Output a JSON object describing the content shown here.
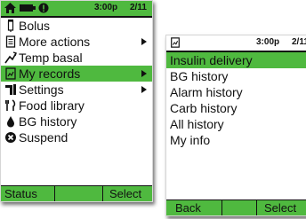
{
  "screen_main": {
    "status_bar": {
      "icons": [
        "home-icon",
        "battery-icon",
        "reservoir-icon"
      ],
      "time": "3:00p",
      "date": "2/11"
    },
    "menu": [
      {
        "label": "Bolus",
        "icon": "syringe-icon",
        "has_submenu": false,
        "selected": false
      },
      {
        "label": "More actions",
        "icon": "document-icon",
        "has_submenu": true,
        "selected": false
      },
      {
        "label": "Temp basal",
        "icon": "temp-basal-icon",
        "has_submenu": false,
        "selected": false
      },
      {
        "label": "My records",
        "icon": "records-icon",
        "has_submenu": true,
        "selected": true
      },
      {
        "label": "Settings",
        "icon": "settings-icon",
        "has_submenu": true,
        "selected": false
      },
      {
        "label": "Food library",
        "icon": "fork-knife-icon",
        "has_submenu": false,
        "selected": false
      },
      {
        "label": "BG history",
        "icon": "blood-drop-icon",
        "has_submenu": false,
        "selected": false
      },
      {
        "label": "Suspend",
        "icon": "suspend-icon",
        "has_submenu": false,
        "selected": false
      }
    ],
    "softkeys": {
      "left": "Status",
      "right": "Select"
    }
  },
  "screen_records": {
    "status_bar": {
      "icons": [
        "records-icon"
      ],
      "time": "3:00p",
      "date": "2/11"
    },
    "menu": [
      {
        "label": "Insulin delivery",
        "selected": true
      },
      {
        "label": "BG history",
        "selected": false
      },
      {
        "label": "Alarm history",
        "selected": false
      },
      {
        "label": "Carb history",
        "selected": false
      },
      {
        "label": "All history",
        "selected": false
      },
      {
        "label": "My info",
        "selected": false
      }
    ],
    "softkeys": {
      "left": "Back",
      "right": "Select"
    }
  },
  "colors": {
    "accent": "#4fb93f",
    "text": "#111111",
    "background": "#ffffff"
  }
}
